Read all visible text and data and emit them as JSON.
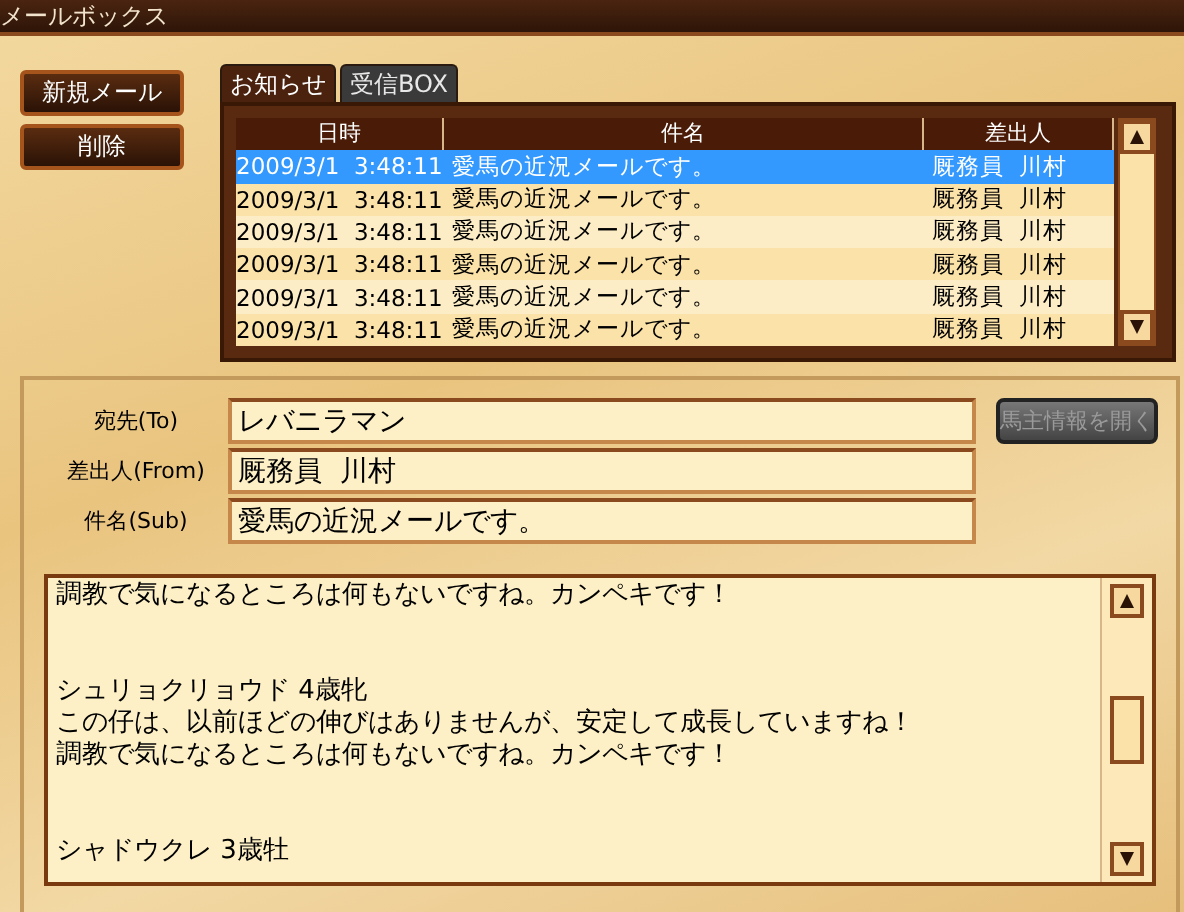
{
  "window": {
    "title": "メールボックス"
  },
  "actions": [
    "新規メール",
    "削除"
  ],
  "tabs": [
    {
      "label": "お知らせ",
      "selected": true
    },
    {
      "label": "受信BOX",
      "selected": false
    }
  ],
  "table": {
    "columns": [
      "日時",
      "件名",
      "差出人"
    ],
    "rows": [
      {
        "cells": [
          "2009/3/1  3:48:11",
          "愛馬の近況メールです。",
          "厩務員  川村"
        ],
        "selected": true
      },
      {
        "cells": [
          "2009/3/1  3:48:11",
          "愛馬の近況メールです。",
          "厩務員  川村"
        ],
        "selected": false
      },
      {
        "cells": [
          "2009/3/1  3:48:11",
          "愛馬の近況メールです。",
          "厩務員  川村"
        ],
        "selected": false
      },
      {
        "cells": [
          "2009/3/1  3:48:11",
          "愛馬の近況メールです。",
          "厩務員  川村"
        ],
        "selected": false
      },
      {
        "cells": [
          "2009/3/1  3:48:11",
          "愛馬の近況メールです。",
          "厩務員  川村"
        ],
        "selected": false
      },
      {
        "cells": [
          "2009/3/1  3:48:11",
          "愛馬の近況メールです。",
          "厩務員  川村"
        ],
        "selected": false
      }
    ]
  },
  "fields": [
    {
      "label": "宛先(To)",
      "value": "レバニラマン"
    },
    {
      "label": "差出人(From)",
      "value": "厩務員  川村"
    },
    {
      "label": "件名(Sub)",
      "value": "愛馬の近況メールです。"
    }
  ],
  "owner_button": {
    "label": "馬主情報を開く",
    "disabled": true
  },
  "message": [
    [
      "調教で気になるところは何もないですね。カンペキです！"
    ],
    [
      "シュリョクリョウド 4歳牝",
      "この仔は、以前ほどの伸びはありませんが、安定して成長していますね！",
      "調教で気になるところは何もないですね。カンペキです！"
    ],
    [
      "シャドウクレ 3歳牡"
    ]
  ]
}
